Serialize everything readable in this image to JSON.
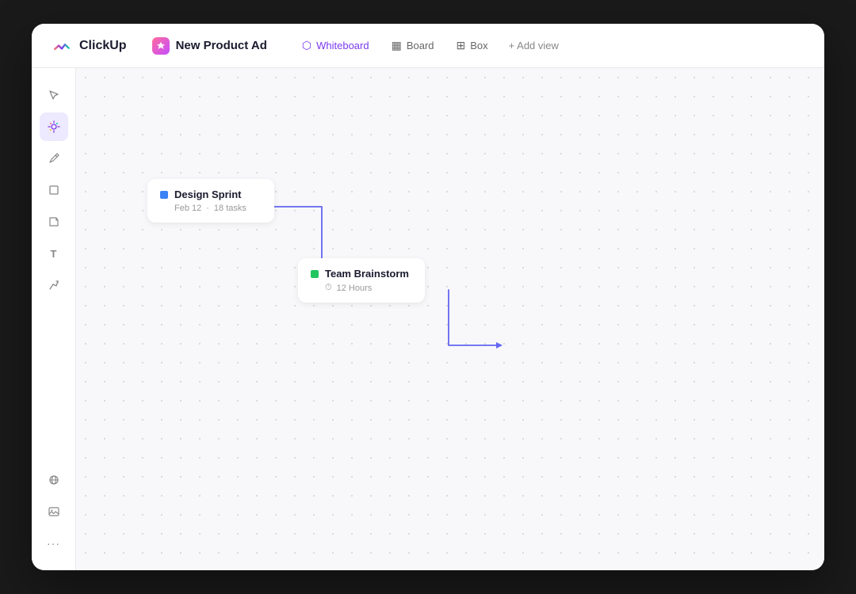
{
  "app": {
    "name": "ClickUp"
  },
  "header": {
    "project_name": "New Product Ad",
    "nav_items": [
      {
        "id": "whiteboard",
        "label": "Whiteboard",
        "icon": "⬡",
        "active": true
      },
      {
        "id": "board",
        "label": "Board",
        "icon": "▦"
      },
      {
        "id": "box",
        "label": "Box",
        "icon": "⊞"
      }
    ],
    "add_view_label": "+ Add view"
  },
  "toolbar": {
    "tools": [
      {
        "id": "cursor",
        "icon": "⬆",
        "label": "Cursor"
      },
      {
        "id": "draw",
        "icon": "✦",
        "label": "Draw"
      },
      {
        "id": "pen",
        "icon": "✏",
        "label": "Pen"
      },
      {
        "id": "rect",
        "icon": "□",
        "label": "Rectangle"
      },
      {
        "id": "note",
        "icon": "⬕",
        "label": "Note"
      },
      {
        "id": "text",
        "icon": "T",
        "label": "Text"
      },
      {
        "id": "connector",
        "icon": "↗",
        "label": "Connector"
      },
      {
        "id": "globe",
        "icon": "⊕",
        "label": "Embed"
      },
      {
        "id": "image",
        "icon": "⬚",
        "label": "Image"
      },
      {
        "id": "more",
        "icon": "···",
        "label": "More"
      }
    ]
  },
  "canvas": {
    "cards": [
      {
        "id": "design-sprint",
        "title": "Design Sprint",
        "color": "blue",
        "meta_date": "Feb 12",
        "meta_tasks": "18 tasks"
      },
      {
        "id": "team-brainstorm",
        "title": "Team Brainstorm",
        "color": "green",
        "meta_icon": "🕐",
        "meta_detail": "12 Hours"
      }
    ]
  }
}
